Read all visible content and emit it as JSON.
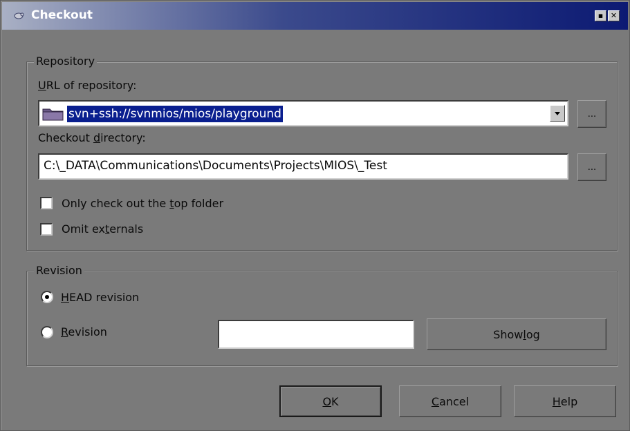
{
  "window": {
    "title": "Checkout"
  },
  "repository": {
    "legend": "Repository",
    "url_label_prefix": "",
    "url_label_u": "U",
    "url_label_rest": "RL of repository:",
    "url_value": "svn+ssh://svnmios/mios/playground",
    "browse_url_label": "...",
    "dir_label_prefix": "Checkout ",
    "dir_label_u": "d",
    "dir_label_rest": "irectory:",
    "dir_value": "C:\\_DATA\\Communications\\Documents\\Projects\\MIOS\\_Test",
    "browse_dir_label": "...",
    "only_top_prefix": "Only check out the ",
    "only_top_u": "t",
    "only_top_rest": "op folder",
    "only_top_checked": false,
    "omit_prefix": "Omit ex",
    "omit_u": "t",
    "omit_rest": "ernals",
    "omit_checked": false
  },
  "revision": {
    "legend": "Revision",
    "head_u": "H",
    "head_rest": "EAD revision",
    "head_selected": true,
    "rev_u": "R",
    "rev_rest": "evision",
    "rev_selected": false,
    "rev_value": "",
    "show_log_prefix": "Show ",
    "show_log_u": "l",
    "show_log_rest": "og"
  },
  "buttons": {
    "ok_u": "O",
    "ok_rest": "K",
    "cancel_u": "C",
    "cancel_rest": "ancel",
    "help_u": "H",
    "help_rest": "elp"
  },
  "colors": {
    "title_gradient_start": "#a9b0c4",
    "title_gradient_end": "#0c1a73",
    "selection": "#0a1f8f",
    "dialog_bg": "#7a7a7a"
  }
}
